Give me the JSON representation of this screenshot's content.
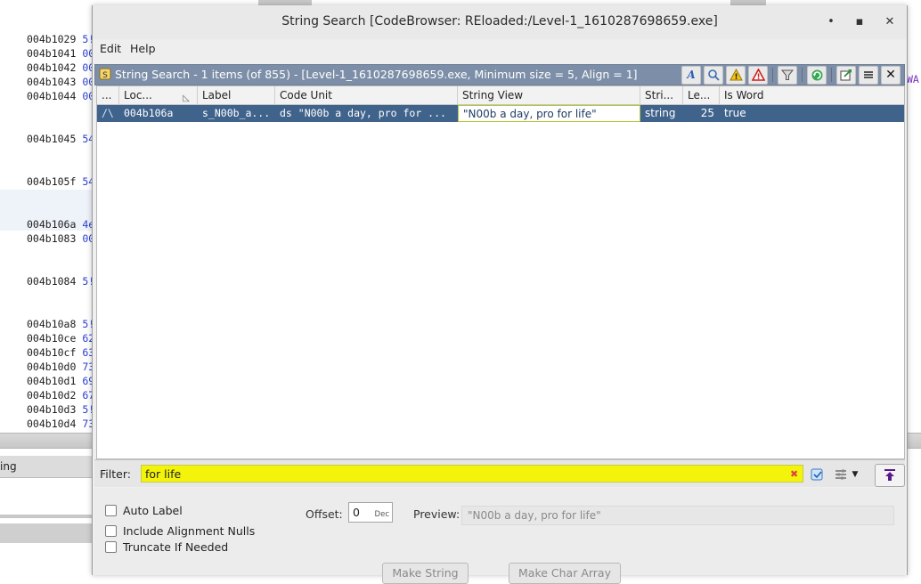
{
  "dialog": {
    "title": "String Search [CodeBrowser: REloaded:/Level-1_1610287698659.exe]",
    "window_controls": {
      "minimize": "•",
      "maximize": "▪",
      "close": "✕"
    },
    "menu": {
      "edit": "Edit",
      "help": "Help"
    }
  },
  "component": {
    "title": "String Search - 1 items (of 855) - [Level-1_1610287698659.exe, Minimum size = 5, Align = 1]",
    "toolbar_icons": [
      "font-icon",
      "search-memory-icon",
      "warning-icon",
      "error-icon",
      "filter-icon",
      "refresh-icon",
      "export-icon",
      "menu-icon",
      "close-icon"
    ]
  },
  "table": {
    "columns": [
      "...",
      "Loc...",
      "Label",
      "Code Unit",
      "String View",
      "Stri...",
      "Le...",
      "Is Word"
    ],
    "rows": [
      {
        "icon": "/\\",
        "location": "004b106a",
        "label": "s_N00b_a...",
        "code_unit": "ds \"N00b a day, pro for ...",
        "string_view": "\"N00b a day, pro for life\"",
        "string_type": "string",
        "length": "25",
        "is_word": "true"
      }
    ]
  },
  "filter": {
    "label": "Filter:",
    "value": "for life",
    "clear": "✖"
  },
  "options": {
    "auto_label": "Auto Label",
    "include_alignment_nulls": "Include Alignment Nulls",
    "truncate_if_needed": "Truncate If Needed",
    "offset_label": "Offset:",
    "offset_value": "0",
    "offset_unit": "Dec",
    "preview_label": "Preview:",
    "preview_value": "\"N00b a day, pro for life\"",
    "make_string": "Make String",
    "make_char_array": "Make Char Array"
  },
  "background": {
    "addresses": [
      {
        "addr": "004b1029",
        "byte": "5!"
      },
      {
        "addr": "004b1041",
        "byte": "00"
      },
      {
        "addr": "004b1042",
        "byte": "00"
      },
      {
        "addr": "004b1043",
        "byte": "00"
      },
      {
        "addr": "004b1044",
        "byte": "00"
      },
      {
        "addr": "004b1045",
        "byte": "54"
      },
      {
        "addr": "004b105f",
        "byte": "54"
      },
      {
        "addr": "004b106a",
        "byte": "4e"
      },
      {
        "addr": "004b1083",
        "byte": "00"
      },
      {
        "addr": "004b1084",
        "byte": "5!"
      },
      {
        "addr": "004b10a8",
        "byte": "5!"
      },
      {
        "addr": "004b10ce",
        "byte": "62"
      },
      {
        "addr": "004b10cf",
        "byte": "63"
      },
      {
        "addr": "004b10d0",
        "byte": "73"
      },
      {
        "addr": "004b10d1",
        "byte": "69"
      },
      {
        "addr": "004b10d2",
        "byte": "67"
      },
      {
        "addr": "004b10d3",
        "byte": "5!"
      },
      {
        "addr": "004b10d4",
        "byte": "73"
      }
    ],
    "right_text": "WA",
    "bottom_tab": "ing"
  }
}
